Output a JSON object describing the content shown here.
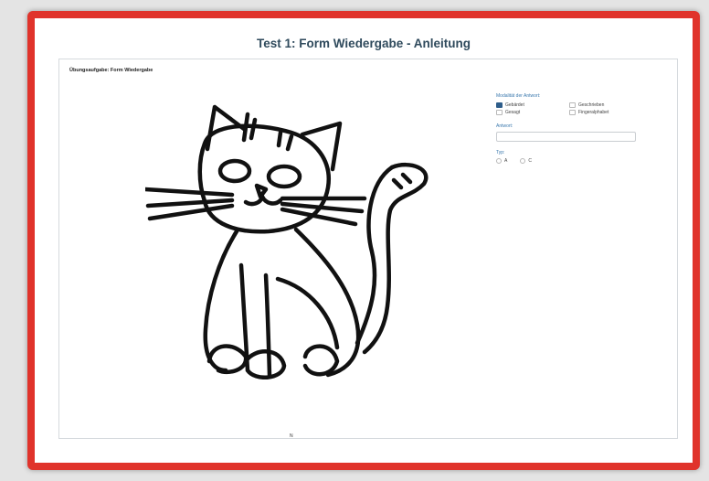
{
  "title": "Test 1: Form Wiedergabe - Anleitung",
  "panel": {
    "header": "Übungsaufgabe: Form Wiedergabe",
    "footer_mark": "N"
  },
  "form": {
    "modality_label": "Modalität der Antwort:",
    "modalities": [
      {
        "label": "Gebärdet",
        "checked": true
      },
      {
        "label": "Geschrieben",
        "checked": false
      },
      {
        "label": "Gesagt",
        "checked": false
      },
      {
        "label": "Fingeralphabet",
        "checked": false
      }
    ],
    "answer_label": "Antwort:",
    "answer_value": "",
    "type_label": "Typ:",
    "types": [
      {
        "label": "A",
        "checked": false
      },
      {
        "label": "C",
        "checked": false
      }
    ]
  },
  "colors": {
    "frame_border": "#e0332b",
    "title_text": "#2f4a5c",
    "label_text": "#3a78ad",
    "checkbox_checked": "#2e5d8a"
  }
}
